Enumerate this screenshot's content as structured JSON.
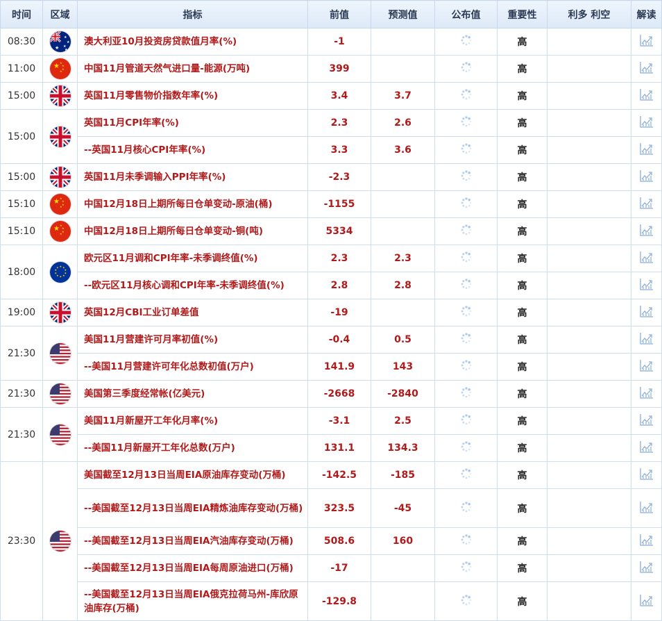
{
  "headers": [
    "时间",
    "区域",
    "指标",
    "前值",
    "预测值",
    "公布值",
    "重要性",
    "利多 利空",
    "解读"
  ],
  "colors": {
    "accent_red": "#b01a1a",
    "header_bg": "#e4eefa",
    "border": "#cfdeef"
  },
  "groups": [
    {
      "time": "08:30",
      "flag": "australia-flag",
      "rows": [
        {
          "indicator": "澳大利亚10月投资房贷款值月率(%)",
          "prev": "-1",
          "forecast": "",
          "importance": "高"
        }
      ]
    },
    {
      "time": "11:00",
      "flag": "china-flag",
      "rows": [
        {
          "indicator": "中国11月管道天然气进口量-能源(万吨)",
          "prev": "399",
          "forecast": "",
          "importance": "高"
        }
      ]
    },
    {
      "time": "15:00",
      "flag": "uk-flag",
      "rows": [
        {
          "indicator": "英国11月零售物价指数年率(%)",
          "prev": "3.4",
          "forecast": "3.7",
          "importance": "高"
        }
      ]
    },
    {
      "time": "15:00",
      "flag": "uk-flag",
      "rows": [
        {
          "indicator": "英国11月CPI年率(%)",
          "prev": "2.3",
          "forecast": "2.6",
          "importance": "高"
        },
        {
          "indicator": "--英国11月核心CPI年率(%)",
          "prev": "3.3",
          "forecast": "3.6",
          "importance": "高"
        }
      ]
    },
    {
      "time": "15:00",
      "flag": "uk-flag",
      "rows": [
        {
          "indicator": "英国11月未季调输入PPI年率(%)",
          "prev": "-2.3",
          "forecast": "",
          "importance": "高"
        }
      ]
    },
    {
      "time": "15:10",
      "flag": "china-flag",
      "rows": [
        {
          "indicator": "中国12月18日上期所每日仓单变动-原油(桶)",
          "prev": "-1155",
          "forecast": "",
          "importance": "高"
        }
      ]
    },
    {
      "time": "15:10",
      "flag": "china-flag",
      "rows": [
        {
          "indicator": "中国12月18日上期所每日仓单变动-铜(吨)",
          "prev": "5334",
          "forecast": "",
          "importance": "高"
        }
      ]
    },
    {
      "time": "18:00",
      "flag": "eu-flag",
      "rows": [
        {
          "indicator": "欧元区11月调和CPI年率-未季调终值(%)",
          "prev": "2.3",
          "forecast": "2.3",
          "importance": "高"
        },
        {
          "indicator": "--欧元区11月核心调和CPI年率-未季调终值(%)",
          "prev": "2.8",
          "forecast": "2.8",
          "importance": "高"
        }
      ]
    },
    {
      "time": "19:00",
      "flag": "uk-flag",
      "rows": [
        {
          "indicator": "英国12月CBI工业订单差值",
          "prev": "-19",
          "forecast": "",
          "importance": "高"
        }
      ]
    },
    {
      "time": "21:30",
      "flag": "us-flag",
      "rows": [
        {
          "indicator": "美国11月营建许可月率初值(%)",
          "prev": "-0.4",
          "forecast": "0.5",
          "importance": "高"
        },
        {
          "indicator": "--美国11月营建许可年化总数初值(万户)",
          "prev": "141.9",
          "forecast": "143",
          "importance": "高"
        }
      ]
    },
    {
      "time": "21:30",
      "flag": "us-flag",
      "rows": [
        {
          "indicator": "美国第三季度经常帐(亿美元)",
          "prev": "-2668",
          "forecast": "-2840",
          "importance": "高"
        }
      ]
    },
    {
      "time": "21:30",
      "flag": "us-flag",
      "rows": [
        {
          "indicator": "美国11月新屋开工年化月率(%)",
          "prev": "-3.1",
          "forecast": "2.5",
          "importance": "高"
        },
        {
          "indicator": "--美国11月新屋开工年化总数(万户)",
          "prev": "131.1",
          "forecast": "134.3",
          "importance": "高"
        }
      ]
    },
    {
      "time": "23:30",
      "flag": "us-flag",
      "rows": [
        {
          "indicator": "美国截至12月13日当周EIA原油库存变动(万桶)",
          "prev": "-142.5",
          "forecast": "-185",
          "importance": "高"
        },
        {
          "indicator": "--美国截至12月13日当周EIA精炼油库存变动(万桶)",
          "prev": "323.5",
          "forecast": "-45",
          "importance": "高",
          "tall": true
        },
        {
          "indicator": "--美国截至12月13日当周EIA汽油库存变动(万桶)",
          "prev": "508.6",
          "forecast": "160",
          "importance": "高"
        },
        {
          "indicator": "--美国截至12月13日当周EIA每周原油进口(万桶)",
          "prev": "-17",
          "forecast": "",
          "importance": "高"
        },
        {
          "indicator": "--美国截至12月13日当周EIA俄克拉荷马州-库欣原油库存(万桶)",
          "prev": "-129.8",
          "forecast": "",
          "importance": "高",
          "tall": true
        }
      ]
    }
  ]
}
